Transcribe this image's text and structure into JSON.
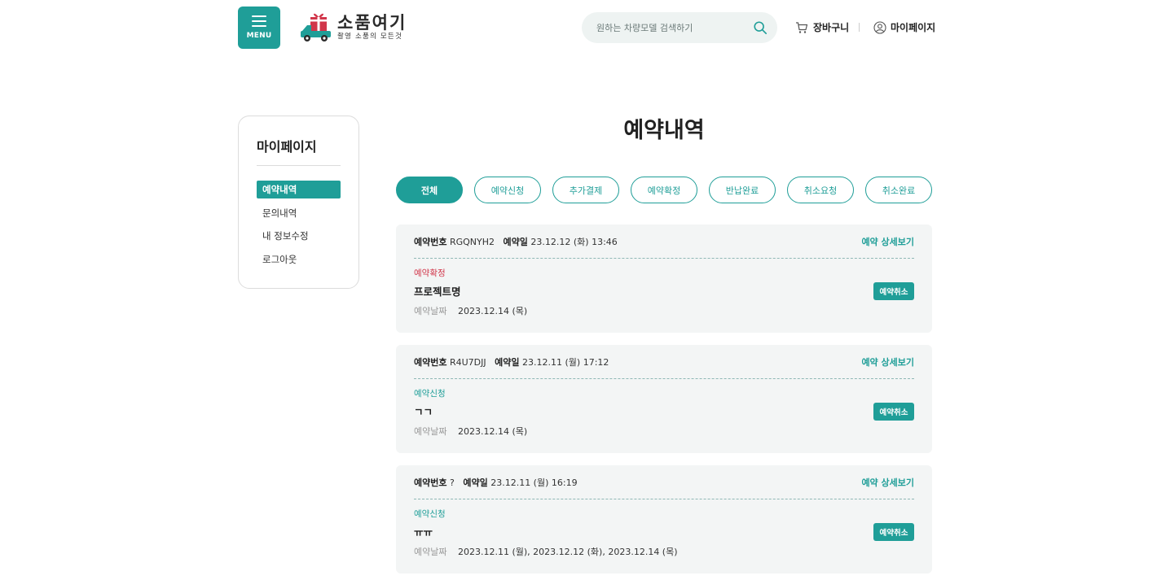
{
  "header": {
    "menu_label": "MENU",
    "logo_main": "소품여기",
    "logo_sub": "촬영 소품의 모든것",
    "search_placeholder": "원하는 차량모델 검색하기",
    "cart_label": "장바구니",
    "mypage_label": "마이페이지"
  },
  "sidebar": {
    "title": "마이페이지",
    "items": [
      {
        "label": "예약내역",
        "active": true
      },
      {
        "label": "문의내역",
        "active": false
      },
      {
        "label": "내 정보수정",
        "active": false
      },
      {
        "label": "로그아웃",
        "active": false
      }
    ]
  },
  "main": {
    "title": "예약내역",
    "tabs": [
      "전체",
      "예약신청",
      "추가결제",
      "예약확정",
      "반납완료",
      "취소요청",
      "취소완료"
    ],
    "reservations": [
      {
        "no_label": "예약번호",
        "no": "RGQNYH2",
        "date_label": "예약일",
        "date": "23.12.12 (화) 13:46",
        "detail_label": "예약 상세보기",
        "status": "예약확정",
        "project": "프로젝트명",
        "dates_label": "예약날짜",
        "dates": "2023.12.14 (목)",
        "cancel_label": "예약취소"
      },
      {
        "no_label": "예약번호",
        "no": "R4U7DJJ",
        "date_label": "예약일",
        "date": "23.12.11 (월) 17:12",
        "detail_label": "예약 상세보기",
        "status": "예약신청",
        "project": "ㄱㄱ",
        "dates_label": "예약날짜",
        "dates": "2023.12.14 (목)",
        "cancel_label": "예약취소"
      },
      {
        "no_label": "예약번호",
        "no": "?",
        "date_label": "예약일",
        "date": "23.12.11 (월) 16:19",
        "detail_label": "예약 상세보기",
        "status": "예약신청",
        "project": "ㅠㅠ",
        "dates_label": "예약날짜",
        "dates": "2023.12.11 (월), 2023.12.12 (화), 2023.12.14 (목)",
        "cancel_label": "예약취소"
      }
    ]
  },
  "colors": {
    "accent": "#1f9e98",
    "status_confirm": "#d1364a",
    "card_bg": "#f3f5f5"
  }
}
